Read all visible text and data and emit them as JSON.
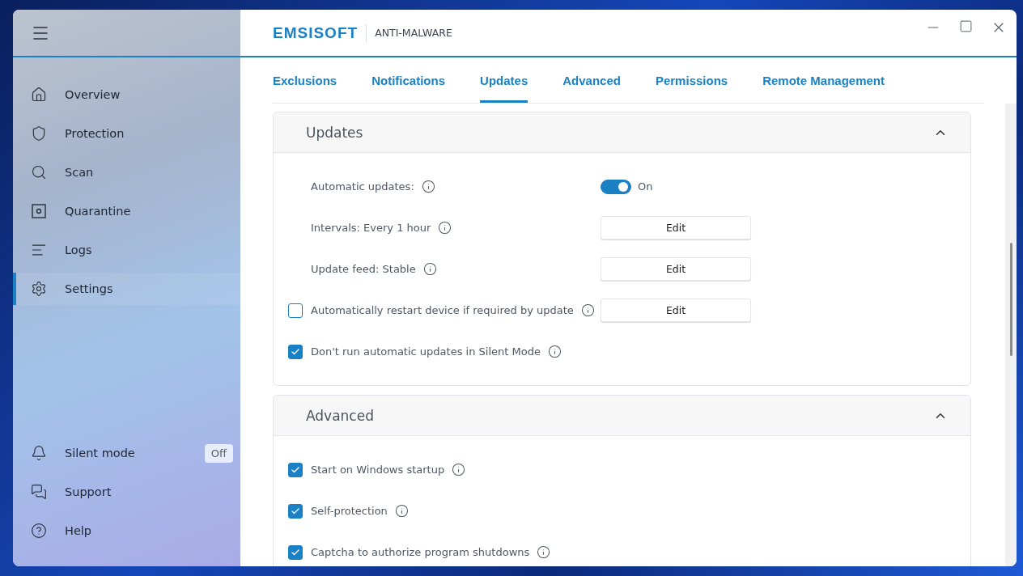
{
  "window": {
    "brand": "EMSISOFT",
    "product": "ANTI-MALWARE"
  },
  "sidebar": {
    "items": [
      {
        "label": "Overview",
        "selected": false
      },
      {
        "label": "Protection",
        "selected": false
      },
      {
        "label": "Scan",
        "selected": false
      },
      {
        "label": "Quarantine",
        "selected": false
      },
      {
        "label": "Logs",
        "selected": false
      },
      {
        "label": "Settings",
        "selected": true
      }
    ],
    "bottom_items": [
      {
        "label": "Silent mode",
        "badge": "Off"
      },
      {
        "label": "Support"
      },
      {
        "label": "Help"
      }
    ]
  },
  "tabs": [
    {
      "label": "Exclusions",
      "selected": false
    },
    {
      "label": "Notifications",
      "selected": false
    },
    {
      "label": "Updates",
      "selected": true
    },
    {
      "label": "Advanced",
      "selected": false
    },
    {
      "label": "Permissions",
      "selected": false
    },
    {
      "label": "Remote Management",
      "selected": false
    }
  ],
  "sections": [
    {
      "title": "Updates",
      "expanded": true,
      "rows": [
        {
          "kind": "toggle",
          "label": "Automatic updates:",
          "on": true,
          "state_text": "On"
        },
        {
          "kind": "edit",
          "label": "Intervals: Every 1 hour",
          "button": "Edit"
        },
        {
          "kind": "edit",
          "label": "Update feed: Stable",
          "button": "Edit"
        },
        {
          "kind": "checkbox",
          "label": "Automatically restart device if required by update",
          "checked": false,
          "button": "Edit"
        },
        {
          "kind": "checkbox",
          "label": "Don't run automatic updates in Silent Mode",
          "checked": true
        }
      ]
    },
    {
      "title": "Advanced",
      "expanded": true,
      "rows": [
        {
          "kind": "checkbox",
          "label": "Start on Windows startup",
          "checked": true
        },
        {
          "kind": "checkbox",
          "label": "Self-protection",
          "checked": true
        },
        {
          "kind": "checkbox",
          "label": "Captcha to authorize program shutdowns",
          "checked": true
        }
      ]
    }
  ]
}
